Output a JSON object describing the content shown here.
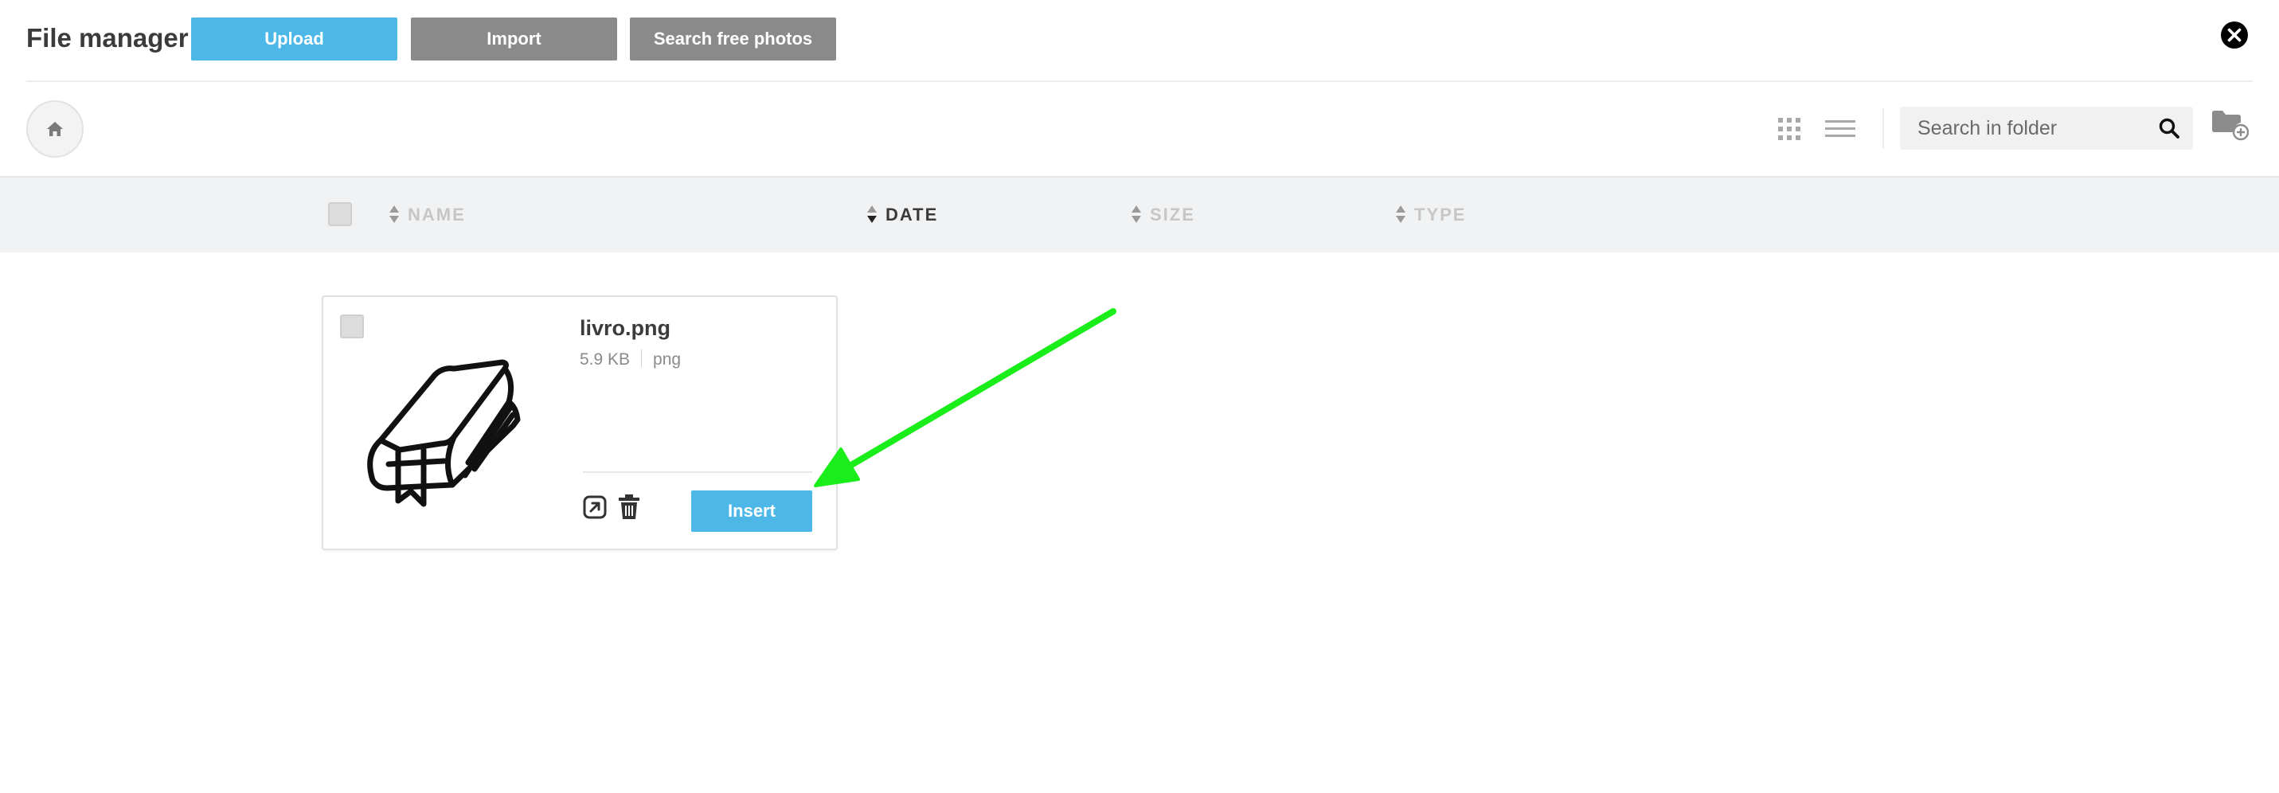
{
  "header": {
    "title": "File manager",
    "upload_label": "Upload",
    "import_label": "Import",
    "search_photos_label": "Search free photos",
    "close_icon": "close-icon"
  },
  "toolbar": {
    "home_icon": "home-icon",
    "grid_view_icon": "grid-view-icon",
    "list_view_icon": "list-view-icon",
    "search": {
      "placeholder": "Search in folder",
      "value": ""
    },
    "new_folder_icon": "new-folder-icon"
  },
  "columns": [
    {
      "label": "NAME",
      "active": false
    },
    {
      "label": "DATE",
      "active": true,
      "sort": "desc"
    },
    {
      "label": "SIZE",
      "active": false
    },
    {
      "label": "TYPE",
      "active": false
    }
  ],
  "files": [
    {
      "name": "livro.png",
      "size": "5.9 KB",
      "type": "png",
      "thumbnail_icon": "book-icon",
      "insert_label": "Insert"
    }
  ],
  "colors": {
    "primary": "#4db8e8",
    "secondary": "#8a8a8a",
    "annotation_arrow": "#1aee1a",
    "header_bar": "#f1f2f3"
  },
  "annotation": {
    "type": "arrow",
    "color": "#1aee1a",
    "points_to": "insert-button"
  }
}
